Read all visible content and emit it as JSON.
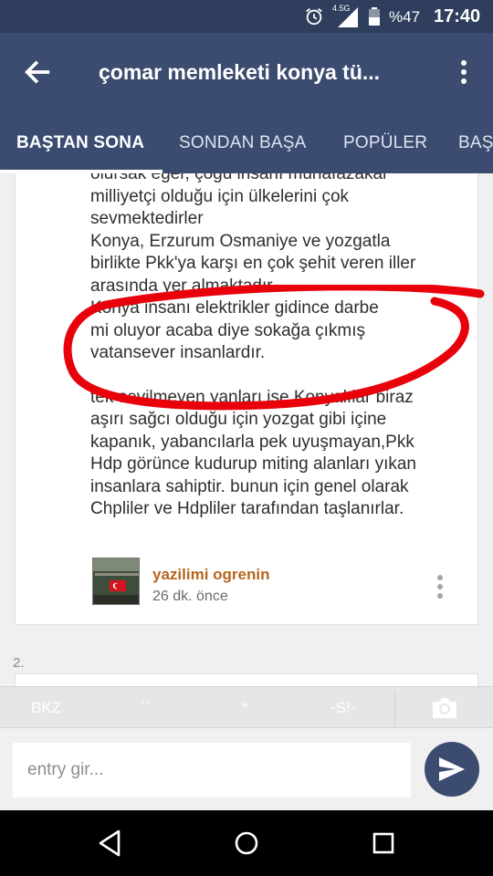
{
  "status_bar": {
    "network": "4.5G",
    "battery_percent": "%47",
    "time": "17:40",
    "icons": [
      "alarm-icon",
      "signal-icon",
      "battery-icon"
    ]
  },
  "app_bar": {
    "title": "çomar memleketi konya tü..."
  },
  "tabs": [
    {
      "label": "BAŞTAN SONA",
      "active": true
    },
    {
      "label": "SONDAN BAŞA",
      "active": false
    },
    {
      "label": "POPÜLER",
      "active": false
    },
    {
      "label": "BAŞ",
      "active": false
    }
  ],
  "entry": {
    "lines": [
      "olursak eğer, çoğu insanı muhafazakar",
      "milliyetçi olduğu için ülkelerini çok",
      "sevmektedirler",
      "Konya, Erzurum Osmaniye ve yozgatla",
      "birlikte Pkk'ya karşı en çok şehit veren iller",
      "arasında yer almaktadır.",
      "Konya insanı elektrikler gidince darbe",
      "mi oluyor acaba diye sokağa çıkmış",
      "vatansever insanlardır.",
      "",
      "tek sevilmeyen yanları ise Konyalılar biraz",
      "aşırı sağcı olduğu için yozgat gibi içine",
      "kapanık, yabancılarla pek uyuşmayan,Pkk",
      "Hdp görünce kudurup miting alanları yıkan",
      "insanlara sahiptir. bunun için genel olarak",
      "Chpliler ve Hdpliler tarafından taşlanırlar."
    ],
    "author": "yazilimi ogrenin",
    "time_ago": "26 dk. önce"
  },
  "next_entry": {
    "number": "2."
  },
  "toolbar": {
    "bkz": "BKZ",
    "quote": "``",
    "star": "*",
    "spoiler": "-S!-"
  },
  "input": {
    "placeholder": "entry gir..."
  },
  "colors": {
    "primary": "#3b4c70",
    "status_bar": "#2f3e5c",
    "author": "#b5651d",
    "annotation": "#e8000b"
  }
}
